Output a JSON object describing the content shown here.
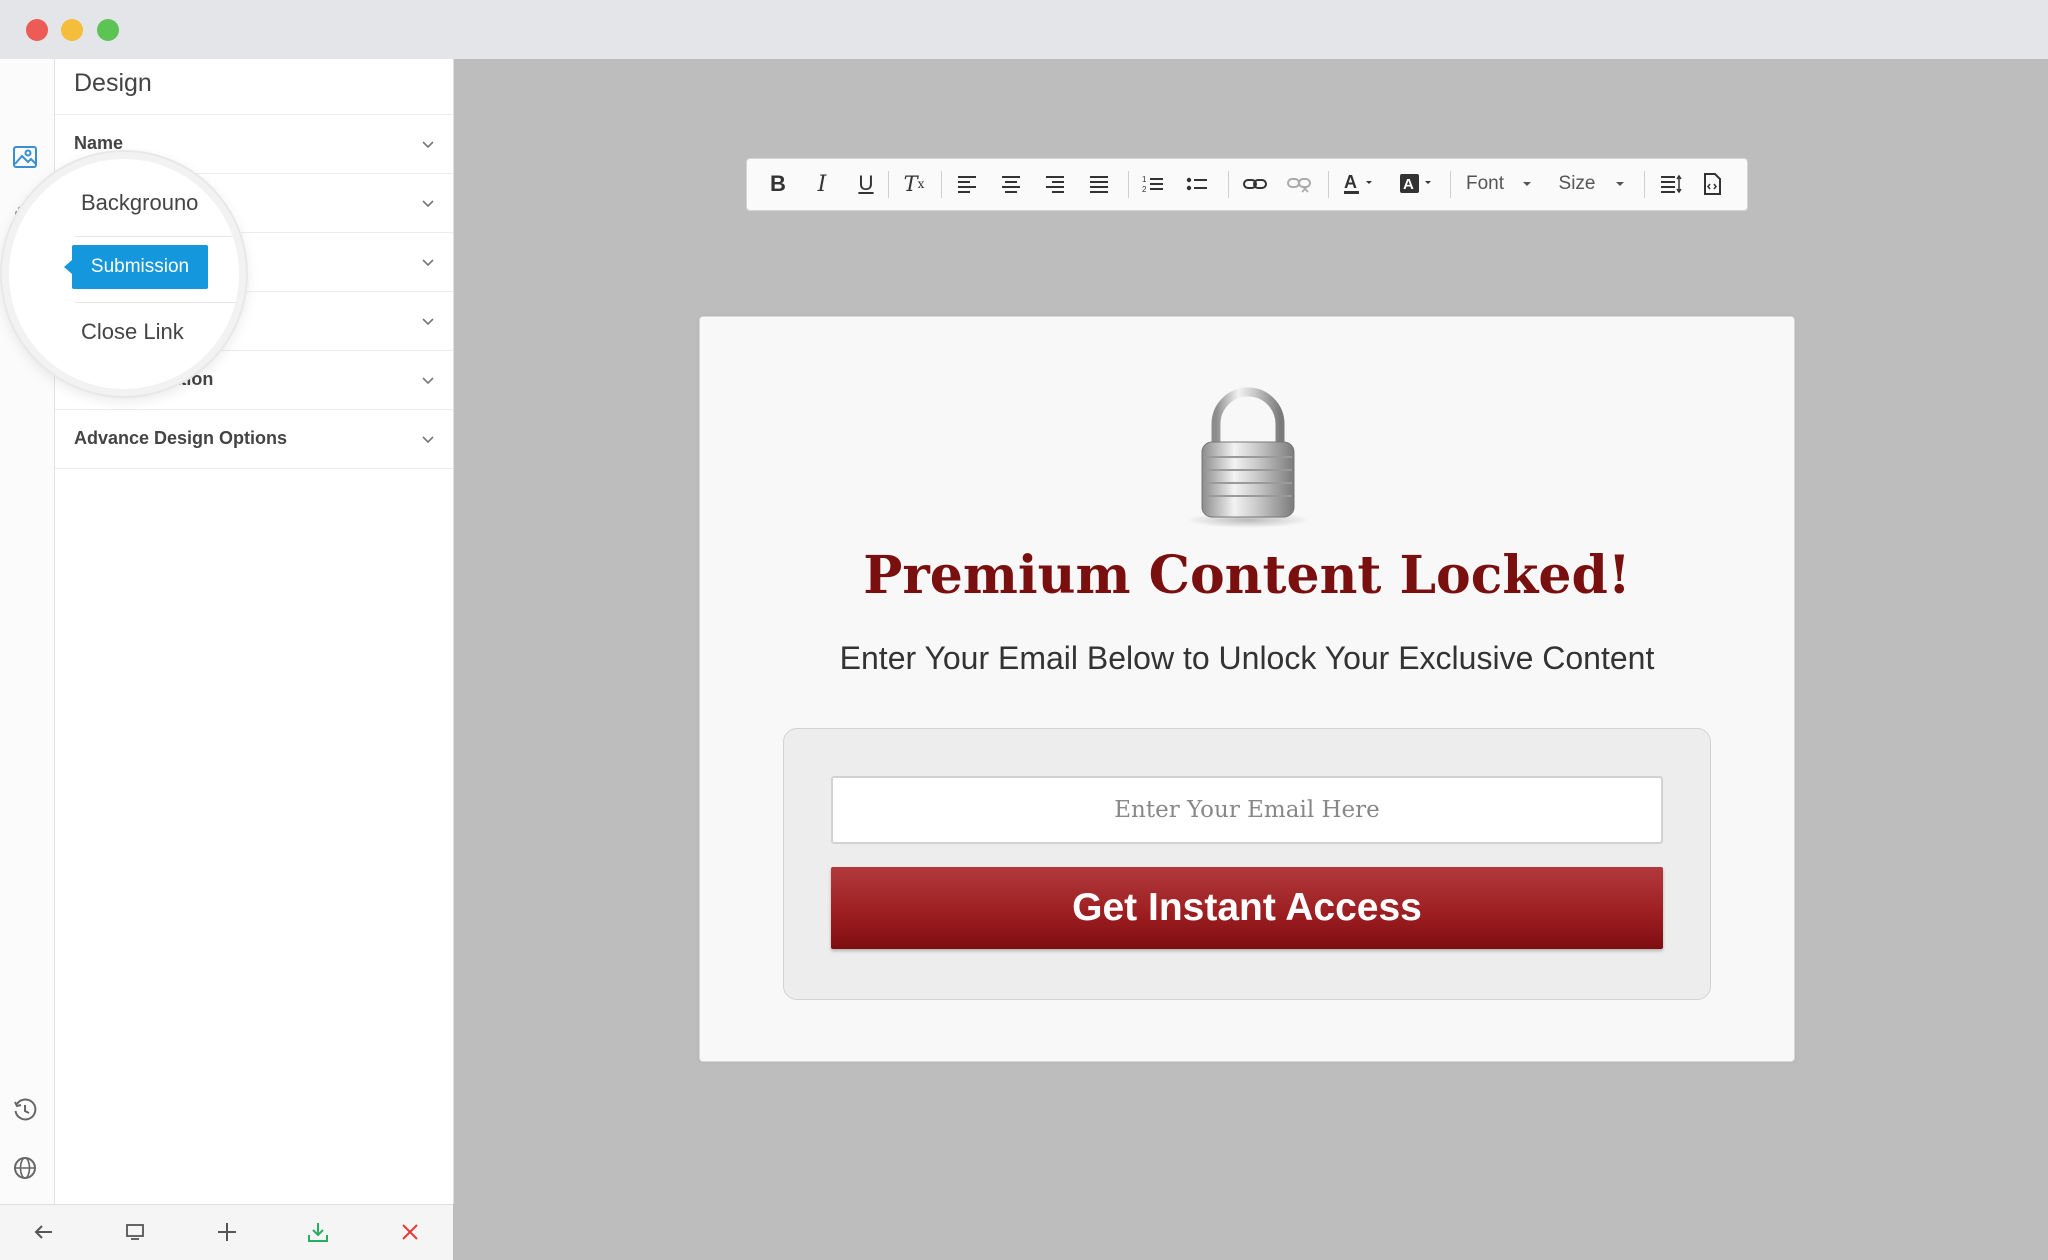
{
  "sidebar": {
    "title": "Design",
    "items": [
      {
        "label": "Name"
      },
      {
        "label": "Background"
      },
      {
        "label": "Submission"
      },
      {
        "label": "Close Link"
      },
      {
        "label": "Modal Animation"
      },
      {
        "label": "Advance Design Options"
      }
    ],
    "partial_labels": {
      "background": "Backgrouno",
      "modal_animation": "Moua Animation"
    },
    "tooltip": "Submission"
  },
  "rail_icons": [
    "image-icon",
    "gear-icon",
    "target-icon",
    "history-icon",
    "globe-icon"
  ],
  "bottom_icons": [
    "back-arrow-icon",
    "device-preview-icon",
    "plus-icon",
    "download-icon",
    "close-icon"
  ],
  "toolbar": {
    "font_label": "Font",
    "size_label": "Size"
  },
  "popup": {
    "headline": "Premium Content Locked!",
    "subheadline": "Enter Your Email Below to Unlock Your Exclusive Content",
    "email_placeholder": "Enter Your Email Here",
    "button_label": "Get Instant Access"
  },
  "colors": {
    "headline": "#7a0f0f",
    "button": "#9e1f22",
    "accent_blue": "#1597dd",
    "download_green": "#27ae60",
    "close_red": "#e53935"
  }
}
